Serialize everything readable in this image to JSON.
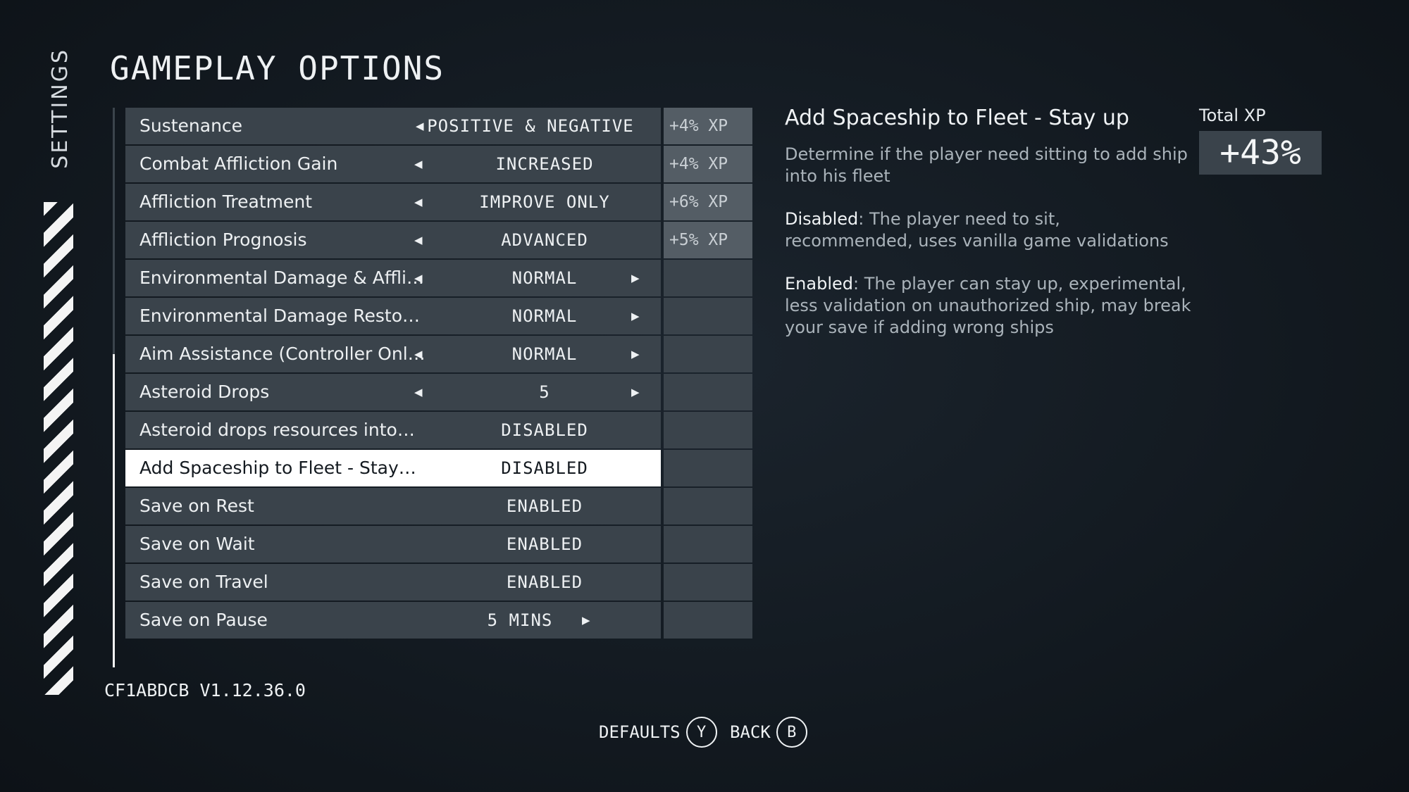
{
  "side_label": "SETTINGS",
  "title": "GAMEPLAY OPTIONS",
  "options": [
    {
      "label": "Sustenance",
      "value": "POSITIVE & NEGATIVE",
      "xp": "+4% XP"
    },
    {
      "label": "Combat Affliction Gain",
      "value": "INCREASED",
      "xp": "+4% XP"
    },
    {
      "label": "Affliction Treatment",
      "value": "IMPROVE ONLY",
      "xp": "+6% XP"
    },
    {
      "label": "Affliction Prognosis",
      "value": "ADVANCED",
      "xp": "+5% XP"
    },
    {
      "label": "Environmental Damage & Affli…",
      "value": "NORMAL",
      "xp": ""
    },
    {
      "label": "Environmental Damage Resto…",
      "value": "NORMAL",
      "xp": ""
    },
    {
      "label": "Aim Assistance (Controller Onl…",
      "value": "NORMAL",
      "xp": ""
    },
    {
      "label": "Asteroid Drops",
      "value": "5",
      "xp": ""
    },
    {
      "label": "Asteroid drops resources into…",
      "value": "DISABLED",
      "xp": ""
    },
    {
      "label": "Add Spaceship to Fleet - Stay…",
      "value": "DISABLED",
      "xp": ""
    },
    {
      "label": "Save on Rest",
      "value": "ENABLED",
      "xp": ""
    },
    {
      "label": "Save on Wait",
      "value": "ENABLED",
      "xp": ""
    },
    {
      "label": "Save on Travel",
      "value": "ENABLED",
      "xp": ""
    },
    {
      "label": "Save on Pause",
      "value": "5 MINS",
      "xp": ""
    }
  ],
  "description": {
    "title": "Add Spaceship to Fleet - Stay up",
    "intro": "Determine if the player need sitting to add ship into his fleet",
    "disabled_term": "Disabled",
    "disabled_text": ": The player need to sit, recommended, uses vanilla game validations",
    "enabled_term": "Enabled",
    "enabled_text": ": The player can stay up, experimental, less validation on unauthorized ship, may break your save if adding wrong ships"
  },
  "total_xp": {
    "label": "Total XP",
    "value": "+43%"
  },
  "version": "CF1ABDCB V1.12.36.0",
  "buttons": {
    "defaults_label": "DEFAULTS",
    "defaults_key": "Y",
    "back_label": "BACK",
    "back_key": "B"
  }
}
